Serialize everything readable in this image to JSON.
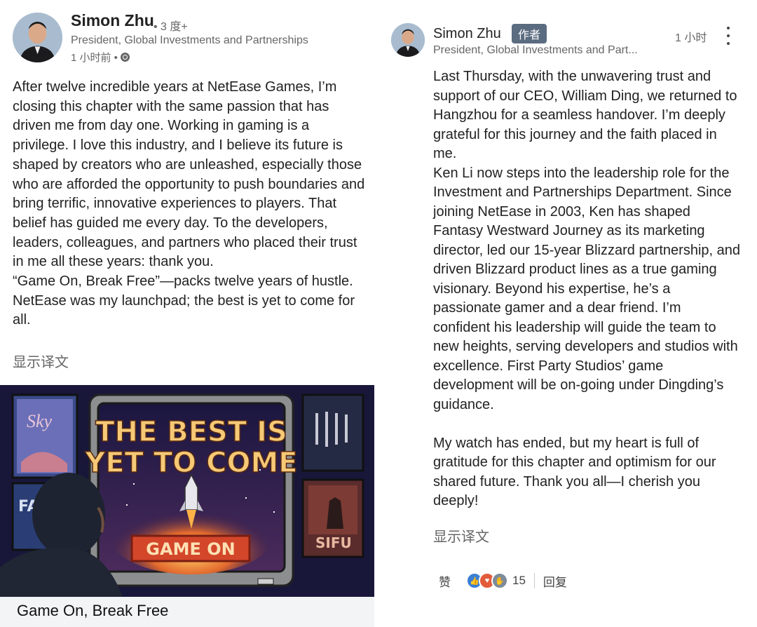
{
  "left_post": {
    "author": "Simon Zhu",
    "degree": "• 3 度+",
    "title": "President, Global Investments and Partnerships",
    "time": "1 小时前 •",
    "body": [
      "After twelve incredible years at NetEase Games, I’m closing this chapter with the same passion that has driven me from day one. Working in gaming is a privilege. I love this industry, and I believe its future is shaped by creators who are unleashed, especially those who are afforded the opportunity to push boundaries and bring terrific, innovative experiences to players. That belief has guided me every day. To the developers, leaders, colleagues, and partners who placed their trust in me all these years: thank you.",
      "“Game On, Break Free”—packs twelve years of hustle. NetEase was my launchpad; the best is yet to come for all."
    ],
    "translate": "显示译文",
    "image": {
      "headline_1": "THE BEST IS",
      "headline_2": "YET TO COME",
      "button": "GAME ON",
      "poster_left_top": "Sky",
      "poster_left_bottom": "FA GU",
      "poster_right_bottom": "SIFU",
      "caption": "Game On, Break Free"
    }
  },
  "right_comment": {
    "author": "Simon Zhu",
    "badge": "作者",
    "time": "1 小时",
    "title": "President, Global Investments and Part...",
    "paragraphs": [
      "Last Thursday, with the unwavering trust and support of our CEO, William Ding, we returned to Hangzhou for a seamless handover. I’m deeply grateful for this journey and the faith placed in me.",
      "Ken Li now steps into the leadership role for the Investment and Partnerships Department. Since joining NetEase in 2003, Ken has shaped Fantasy Westward Journey as its marketing director, led our 15-year Blizzard partnership, and driven Blizzard product lines as a true gaming visionary. Beyond his expertise, he’s a passionate gamer and a dear friend. I’m confident his leadership will guide the team to new heights, serving developers and studios with excellence. First Party Studios’ game development will be on-going under Dingding’s guidance.",
      "My watch has ended, but my heart is full of gratitude for this chapter and optimism for our shared future. Thank you all—I cherish you deeply!"
    ],
    "translate": "显示译文",
    "actions": {
      "like": "赞",
      "reaction_count": "15",
      "reply": "回复"
    }
  }
}
